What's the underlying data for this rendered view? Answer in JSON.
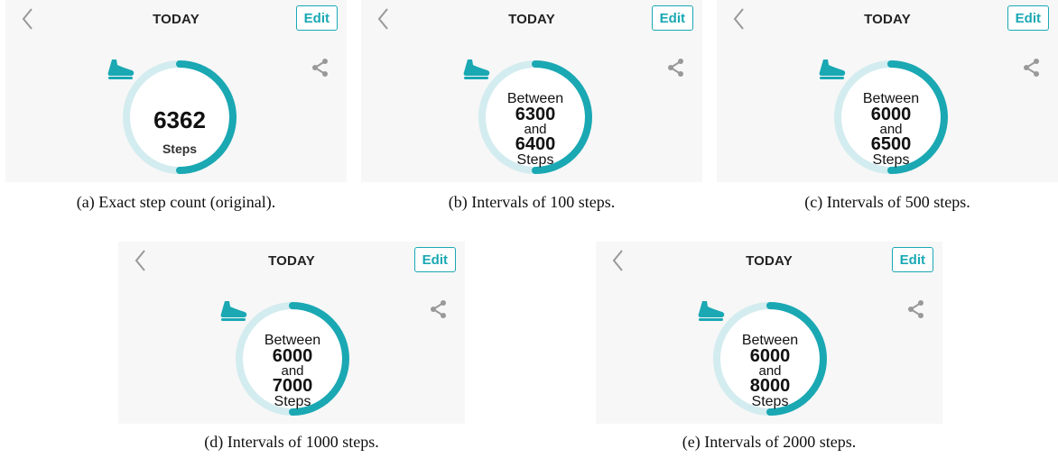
{
  "screen": {
    "title": "TODAY",
    "edit_label": "Edit",
    "icons": [
      "chevron-left-icon",
      "share-icon",
      "shoe-icon"
    ],
    "colors": {
      "accent": "#1aa8b3",
      "ring_track": "#d3ecef",
      "panel_bg": "#f7f7f7"
    }
  },
  "panels": [
    {
      "caption": "(a) Exact step count (original).",
      "value": "6362",
      "unit": "Steps"
    },
    {
      "caption": "(b) Intervals of 100 steps.",
      "between": "Between",
      "low": "6300",
      "and": "and",
      "high": "6400",
      "unit": "Steps"
    },
    {
      "caption": "(c) Intervals of 500 steps.",
      "between": "Between",
      "low": "6000",
      "and": "and",
      "high": "6500",
      "unit": "Steps"
    },
    {
      "caption": "(d) Intervals of 1000 steps.",
      "between": "Between",
      "low": "6000",
      "and": "and",
      "high": "7000",
      "unit": "Steps"
    },
    {
      "caption": "(e) Intervals of 2000 steps.",
      "between": "Between",
      "low": "6000",
      "and": "and",
      "high": "8000",
      "unit": "Steps"
    }
  ],
  "progress_fraction": 0.5
}
